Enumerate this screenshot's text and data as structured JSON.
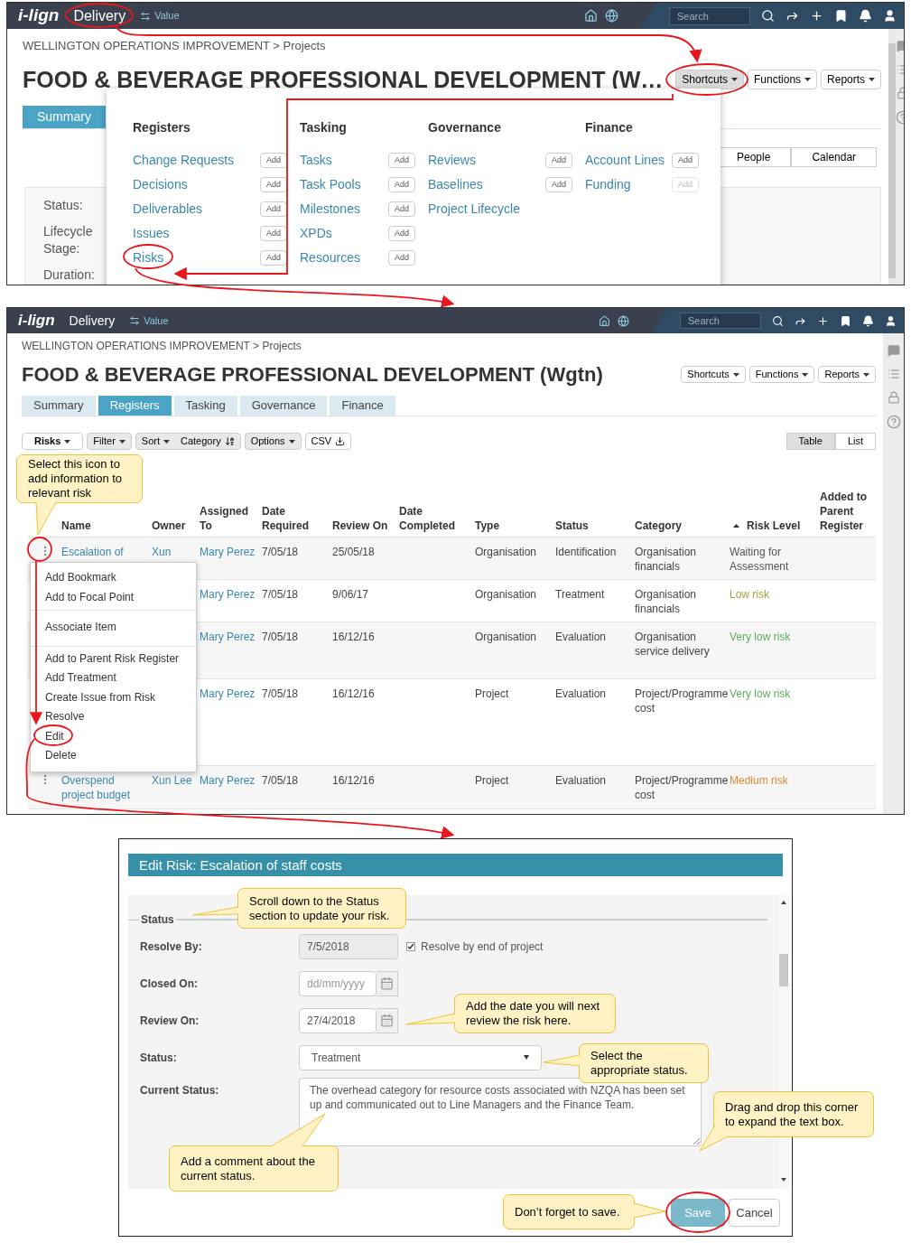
{
  "top_screen": {
    "topbar": {
      "logo": "i-lign",
      "module": "Delivery",
      "switch": "Value",
      "search": {
        "placeholder": "Search"
      }
    },
    "breadcrumb": "WELLINGTON OPERATIONS IMPROVEMENT > Projects",
    "title": "FOOD & BEVERAGE PROFESSIONAL DEVELOPMENT (W…",
    "menus": [
      {
        "label": "Shortcuts",
        "selected": true
      },
      {
        "label": "Functions",
        "selected": false
      },
      {
        "label": "Reports",
        "selected": false
      }
    ],
    "tabs": [
      {
        "label": "Summary",
        "selected": true
      }
    ],
    "view_buttons": [
      "People",
      "Calendar"
    ],
    "fields": [
      "Status:",
      "Lifecycle Stage:",
      "Duration:"
    ],
    "shortcuts_menu": [
      {
        "heading": "Registers",
        "items": [
          {
            "label": "Change Requests",
            "add": "Add",
            "disabled": false
          },
          {
            "label": "Decisions",
            "add": "Add",
            "disabled": false
          },
          {
            "label": "Deliverables",
            "add": "Add",
            "disabled": false
          },
          {
            "label": "Issues",
            "add": "Add",
            "disabled": false
          },
          {
            "label": "Risks",
            "add": "Add",
            "disabled": false
          }
        ]
      },
      {
        "heading": "Tasking",
        "items": [
          {
            "label": "Tasks",
            "add": "Add",
            "disabled": false
          },
          {
            "label": "Task Pools",
            "add": "Add",
            "disabled": false
          },
          {
            "label": "Milestones",
            "add": "Add",
            "disabled": false
          },
          {
            "label": "XPDs",
            "add": "Add",
            "disabled": false
          },
          {
            "label": "Resources",
            "add": "Add",
            "disabled": false
          }
        ]
      },
      {
        "heading": "Governance",
        "items": [
          {
            "label": "Reviews",
            "add": "Add",
            "disabled": false
          },
          {
            "label": "Baselines",
            "add": "Add",
            "disabled": false
          },
          {
            "label": "Project Lifecycle"
          }
        ]
      },
      {
        "heading": "Finance",
        "items": [
          {
            "label": "Account Lines",
            "add": "Add",
            "disabled": false
          },
          {
            "label": "Funding",
            "add": "Add",
            "disabled": true
          }
        ]
      }
    ]
  },
  "register_screen": {
    "topbar": {
      "logo": "i-lign",
      "module": "Delivery",
      "switch": "Value",
      "search": {
        "placeholder": "Search"
      }
    },
    "breadcrumb": "WELLINGTON OPERATIONS IMPROVEMENT > Projects",
    "title": "FOOD & BEVERAGE PROFESSIONAL DEVELOPMENT (Wgtn)",
    "menus": [
      {
        "label": "Shortcuts",
        "selected": false
      },
      {
        "label": "Functions",
        "selected": false
      },
      {
        "label": "Reports",
        "selected": false
      }
    ],
    "tabs": [
      {
        "label": "Summary",
        "selected": false
      },
      {
        "label": "Registers",
        "selected": true
      },
      {
        "label": "Tasking",
        "selected": false
      },
      {
        "label": "Governance",
        "selected": false
      },
      {
        "label": "Finance",
        "selected": false
      }
    ],
    "toolbar": [
      {
        "kind": "dropdown",
        "label": "Risks",
        "selected": true
      },
      {
        "kind": "dropdown",
        "label": "Filter",
        "selected": false
      },
      {
        "kind": "sort",
        "label": "Sort",
        "value": "Category",
        "selected": false
      },
      {
        "kind": "dropdown",
        "label": "Options",
        "selected": false
      },
      {
        "kind": "csv",
        "label": "CSV",
        "selected": true
      }
    ],
    "view_toggle": [
      {
        "label": "Table",
        "selected": true
      },
      {
        "label": "List",
        "selected": false
      }
    ],
    "callout": "Select this icon to add information to relevant risk",
    "table": {
      "columns": [
        {
          "label": "Name",
          "sorted": false
        },
        {
          "label": "Owner",
          "sorted": false
        },
        {
          "label": "Assigned To",
          "sorted": false
        },
        {
          "label": "Date Required",
          "sorted": false
        },
        {
          "label": "Review On",
          "sorted": false
        },
        {
          "label": "Date Completed",
          "sorted": false
        },
        {
          "label": "Type",
          "sorted": false
        },
        {
          "label": "Status",
          "sorted": false
        },
        {
          "label": "Category",
          "sorted": false
        },
        {
          "label": "Risk Level",
          "sorted": true
        },
        {
          "label": "Added to Parent Register",
          "sorted": false
        }
      ],
      "rows": [
        {
          "name": "Escalation of",
          "owner": "Xun",
          "assigned_to": "Mary Perez",
          "date_required": "7/05/18",
          "review_on": "25/05/18",
          "type": "Organisation",
          "status": "Identification",
          "category": "Organisation financials",
          "risk_level": "Waiting for Assessment",
          "color": "#555555"
        },
        {
          "assigned_to": "Mary Perez",
          "date_required": "7/05/18",
          "review_on": "9/06/17",
          "type": "Organisation",
          "status": "Treatment",
          "category": "Organisation financials",
          "risk_level": "Low risk",
          "color": "#a3a33c"
        },
        {
          "assigned_to": "Mary Perez",
          "date_required": "7/05/18",
          "review_on": "16/12/16",
          "type": "Organisation",
          "status": "Evaluation",
          "category": "Organisation service delivery",
          "risk_level": "Very low risk",
          "color": "#5cae5c"
        },
        {
          "assigned_to": "Mary Perez",
          "date_required": "7/05/18",
          "review_on": "16/12/16",
          "type": "Project",
          "status": "Evaluation",
          "category": "Project/Programme cost",
          "risk_level": "Very low risk",
          "color": "#5cae5c"
        },
        {
          "name": "Overspend project budget",
          "owner": "Xun Lee",
          "assigned_to": "Mary Perez",
          "date_required": "7/05/18",
          "review_on": "16/12/16",
          "type": "Project",
          "status": "Evaluation",
          "category": "Project/Programme cost",
          "risk_level": "Medium risk",
          "color": "#e0873a"
        }
      ]
    },
    "row_menu": [
      [
        "Add Bookmark",
        "Add to Focal Point"
      ],
      [
        "Associate Item"
      ],
      [
        "Add to Parent Risk Register",
        "Add Treatment",
        "Create Issue from Risk",
        "Resolve",
        "Edit",
        "Delete"
      ]
    ]
  },
  "edit_dialog": {
    "title": "Edit Risk: Escalation of staff costs",
    "section": "Status",
    "fields": [
      {
        "kind": "date",
        "label": "Resolve By:",
        "value": "7/5/2018",
        "disabled": true,
        "checkbox": {
          "label": "Resolve by end of project",
          "checked": true
        }
      },
      {
        "kind": "date",
        "label": "Closed On:",
        "placeholder": "dd/mm/yyyy",
        "disabled": false
      },
      {
        "kind": "date",
        "label": "Review On:",
        "value": "27/4/2018",
        "disabled": false
      },
      {
        "kind": "select",
        "label": "Status:",
        "value": "Treatment"
      },
      {
        "kind": "textarea",
        "label": "Current Status:",
        "value": "The overhead category for resource costs associated with NZQA has been set up and communicated out to Line Managers and the Finance Team."
      }
    ],
    "buttons": [
      {
        "kind": "primary",
        "label": "Save"
      },
      {
        "kind": "default",
        "label": "Cancel"
      }
    ],
    "callouts": [
      "Scroll down to the Status section to update your risk.",
      "Add the date you will next review the risk here.",
      "Select the appropriate status.",
      "Drag and drop this corner to expand the text box.",
      "Add a comment about the current status.",
      "Don’t forget to save."
    ]
  }
}
